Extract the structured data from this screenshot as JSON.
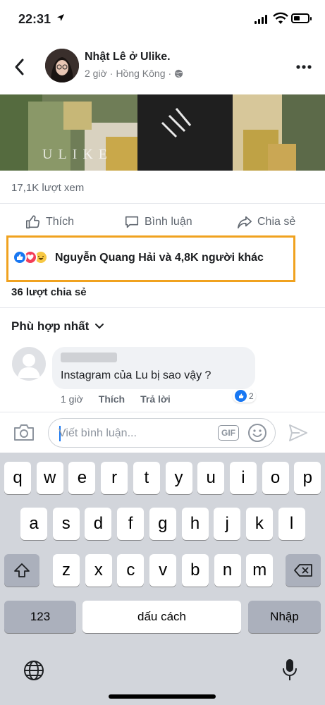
{
  "status_bar": {
    "time": "22:31"
  },
  "post": {
    "author": "Nhật Lê ở Ulike.",
    "time": "2 giờ",
    "location": "Hồng Kông",
    "video_watermark": "ULIKE",
    "views": "17,1K lượt xem"
  },
  "actions": {
    "like": "Thích",
    "comment": "Bình luận",
    "share": "Chia sẻ"
  },
  "reactions": {
    "icons": [
      "like-icon",
      "heart-icon",
      "haha-icon"
    ],
    "summary": "Nguyễn Quang Hải và 4,8K người khác",
    "highlight_color": "#f0a21f"
  },
  "shares": "36 lượt chia sẻ",
  "sort": {
    "label": "Phù hợp nhất"
  },
  "comment": {
    "text": "Instagram của Lu bị sao vậy ?",
    "time": "1 giờ",
    "like_label": "Thích",
    "reply_label": "Trả lời",
    "reaction_count": "2"
  },
  "composer": {
    "placeholder": "Viết bình luận...",
    "gif_label": "GIF"
  },
  "keyboard": {
    "row1": [
      "q",
      "w",
      "e",
      "r",
      "t",
      "y",
      "u",
      "i",
      "o",
      "p"
    ],
    "row2": [
      "a",
      "s",
      "d",
      "f",
      "g",
      "h",
      "j",
      "k",
      "l"
    ],
    "row3": [
      "z",
      "x",
      "c",
      "v",
      "b",
      "n",
      "m"
    ],
    "numbers_label": "123",
    "space_label": "dấu cách",
    "return_label": "Nhập"
  },
  "colors": {
    "brand_blue": "#1877f2",
    "keyboard_bg": "#d2d5db"
  }
}
